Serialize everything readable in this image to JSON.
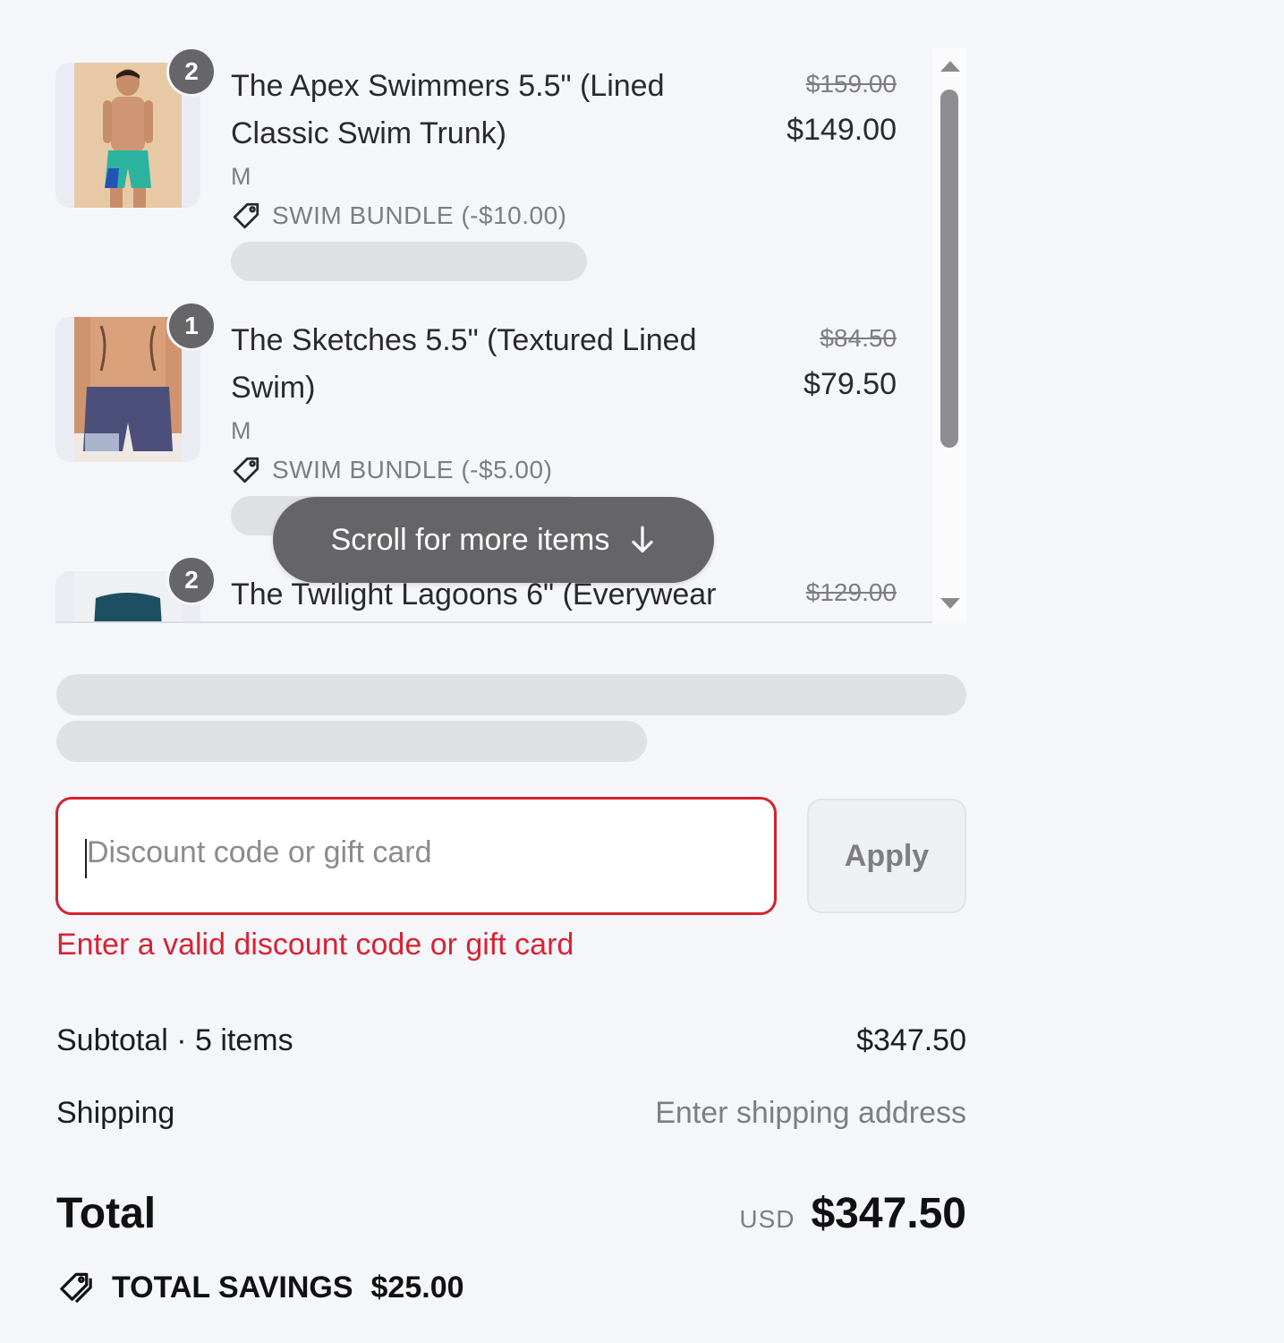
{
  "items": [
    {
      "quantity": "2",
      "title": "The Apex Swimmers 5.5\" (Lined Classic Swim Trunk)",
      "variant": "M",
      "discount": "SWIM BUNDLE (-$10.00)",
      "original_price": "$159.00",
      "price": "$149.00",
      "image": "swimmer-teal-trunks"
    },
    {
      "quantity": "1",
      "title": "The Sketches 5.5\" (Textured Lined Swim)",
      "variant": "M",
      "discount": "SWIM BUNDLE (-$5.00)",
      "original_price": "$84.50",
      "price": "$79.50",
      "image": "swimmer-navy-trunks"
    },
    {
      "quantity": "2",
      "title": "The Twilight Lagoons 6\" (Everywear",
      "original_price": "$129.00",
      "image": "swimmer-dark-teal-trunks"
    }
  ],
  "scroll_hint": {
    "label": "Scroll for more items",
    "icon": "arrow-down-icon"
  },
  "discount_code": {
    "placeholder": "Discount code or gift card",
    "value": "",
    "apply_label": "Apply",
    "error": "Enter a valid discount code or gift card",
    "error_color": "#d82333"
  },
  "summary": {
    "subtotal_label": "Subtotal · 5 items",
    "subtotal_value": "$347.50",
    "shipping_label": "Shipping",
    "shipping_value": "Enter shipping address",
    "total_label": "Total",
    "currency": "USD",
    "total_value": "$347.50",
    "savings_label": "TOTAL SAVINGS",
    "savings_value": "$25.00",
    "savings_icon": "tags-icon"
  }
}
